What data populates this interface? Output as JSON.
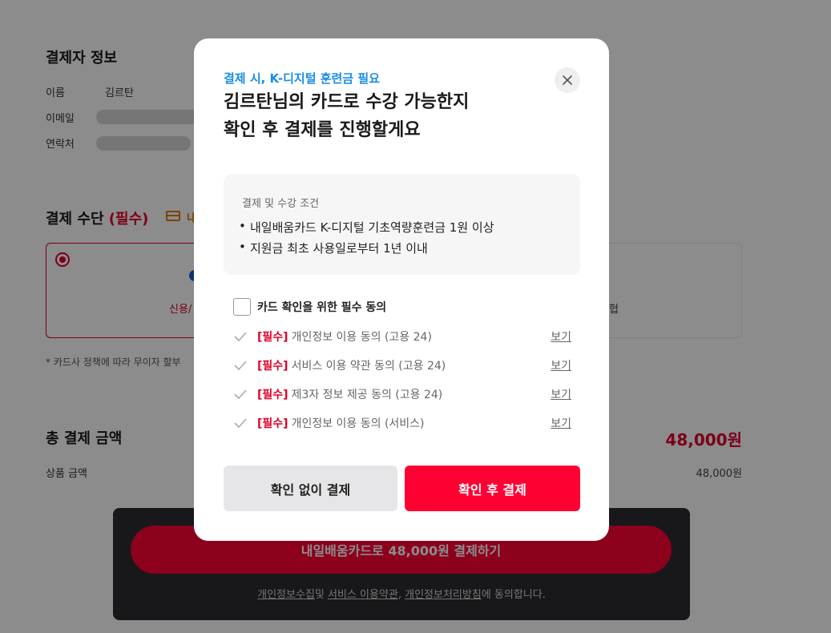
{
  "payer": {
    "section_title": "결제자 정보",
    "name_label": "이름",
    "name_value": "김르탄",
    "email_label": "이메일",
    "phone_label": "연락처"
  },
  "payment_method": {
    "title": "결제 수단",
    "required": "(필수)",
    "card_label_partial": "내",
    "selected_option_partial": "신용/",
    "other_option_partial": "협",
    "installment_note": "* 카드사 정책에 따라 무이자 할부"
  },
  "total": {
    "title": "총 결제 금액",
    "amount": "48,000원",
    "product_label": "상품 금액",
    "product_amount": "48,000원"
  },
  "bottom": {
    "pay_button": "내일배움카드로 48,000원 결제하기",
    "agree_link1": "개인정보수집",
    "agree_mid1": "및 ",
    "agree_link2": "서비스 이용약관",
    "agree_mid2": ", ",
    "agree_link3": "개인정보처리방침",
    "agree_tail": "에 동의합니다."
  },
  "modal": {
    "subtitle": "결제 시, K-디지털 훈련금 필요",
    "title_line1": "김르탄님의 카드로 수강 가능한지",
    "title_line2": "확인 후 결제를 진행할게요",
    "conditions_title": "결제 및 수강 조건",
    "conditions": [
      "내일배움카드 K-디지털 기초역량훈련금 1원 이상",
      "지원금 최초 사용일로부터 1년 이내"
    ],
    "agree_all_label": "카드 확인을 위한 필수 동의",
    "agreements": [
      {
        "tag": "[필수]",
        "text": "개인정보 이용 동의 (고용 24)",
        "link": "보기"
      },
      {
        "tag": "[필수]",
        "text": "서비스 이용 약관 동의 (고용 24)",
        "link": "보기"
      },
      {
        "tag": "[필수]",
        "text": "제3자 정보 제공 동의 (고용 24)",
        "link": "보기"
      },
      {
        "tag": "[필수]",
        "text": "개인정보 이용 동의 (서비스)",
        "link": "보기"
      }
    ],
    "btn_skip": "확인 없이 결제",
    "btn_confirm": "확인 후 결제"
  },
  "colors": {
    "accent_red": "#ff0033",
    "subtitle_blue": "#1a8ee0",
    "overlay": "rgba(0,0,0,0.45)"
  }
}
